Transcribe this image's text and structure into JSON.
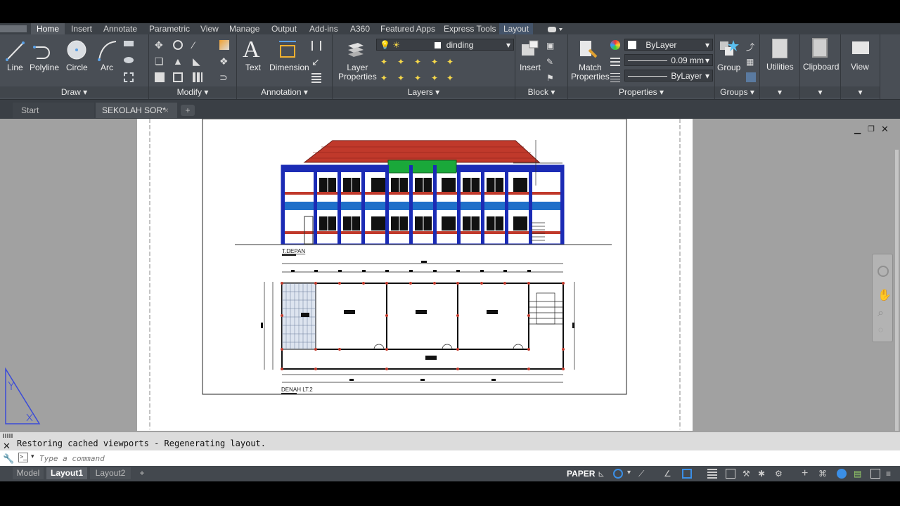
{
  "ribbon_tabs": [
    "Home",
    "Insert",
    "Annotate",
    "Parametric",
    "View",
    "Manage",
    "Output",
    "Add-ins",
    "A360",
    "Featured Apps",
    "Express Tools",
    "Layout"
  ],
  "active_tab": "Home",
  "draw": {
    "line": "Line",
    "polyline": "Polyline",
    "circle": "Circle",
    "arc": "Arc",
    "title": "Draw ▾"
  },
  "modify": {
    "title": "Modify ▾"
  },
  "annotation": {
    "text": "Text",
    "dimension": "Dimension",
    "title": "Annotation ▾"
  },
  "layers": {
    "layer_properties": "Layer\nProperties",
    "current_layer": "dinding",
    "title": "Layers ▾"
  },
  "block": {
    "insert": "Insert",
    "title": "Block ▾"
  },
  "properties": {
    "match": "Match\nProperties",
    "color": "ByLayer",
    "lineweight": "0.09 mm",
    "linetype": "ByLayer",
    "title": "Properties ▾"
  },
  "groups": {
    "group": "Group",
    "title": "Groups ▾"
  },
  "utilities": "Utilities",
  "clipboard": "Clipboard",
  "view": "View",
  "doc_tabs": {
    "start": "Start",
    "file": "SEKOLAH SOR*",
    "close": "×",
    "new": "+"
  },
  "drawing": {
    "elevation_label": "T.DEPAN",
    "plan_label": "DENAH LT.2"
  },
  "command": {
    "history": "Restoring cached viewports - Regenerating layout.",
    "placeholder": "Type a command"
  },
  "layout_tabs": {
    "model": "Model",
    "layout1": "Layout1",
    "layout2": "Layout2",
    "add": "+"
  },
  "status": {
    "paper": "PAPER"
  },
  "colors": {
    "ribbon": "#494e55",
    "tabbar": "#3c4147",
    "canvas": "#a1a1a1",
    "roof": "#c0392b",
    "accent_blue": "#1f6fc9",
    "navy": "#1b2bb5",
    "green": "#1aa83a",
    "ucs": "#3a4bd8"
  }
}
